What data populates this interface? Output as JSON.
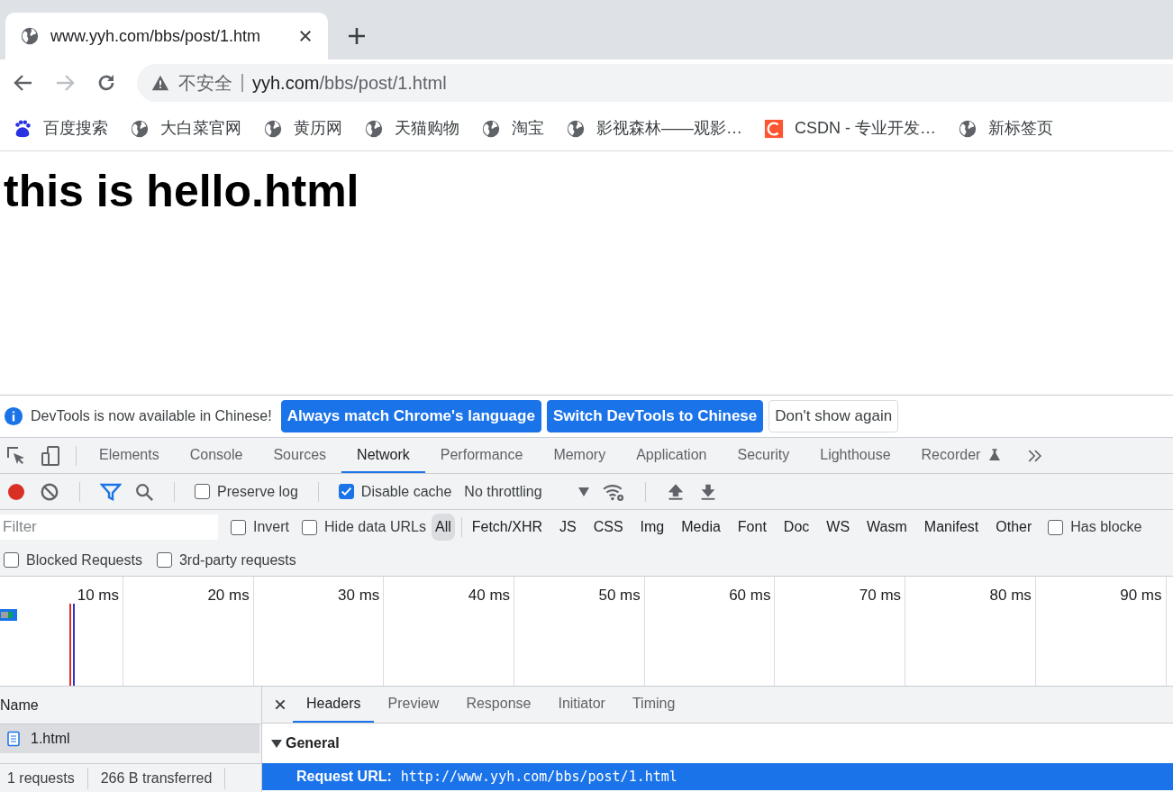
{
  "browser_tabs": [
    {
      "title": "www.yyh.com/bbs/post/1.htm",
      "selected": true
    }
  ],
  "address_bar": {
    "security": "不安全",
    "host": "yyh.com",
    "path": "/bbs/post/1.html"
  },
  "bookmarks": [
    {
      "label": "百度搜索",
      "kind": "baidu"
    },
    {
      "label": "大白菜官网",
      "kind": "globe"
    },
    {
      "label": "黄历网",
      "kind": "globe"
    },
    {
      "label": "天猫购物",
      "kind": "globe"
    },
    {
      "label": "淘宝",
      "kind": "globe"
    },
    {
      "label": "影视森林——观影…",
      "kind": "globe"
    },
    {
      "label": "CSDN - 专业开发…",
      "kind": "csdn"
    },
    {
      "label": "新标签页",
      "kind": "globe"
    }
  ],
  "page": {
    "heading": "this is hello.html"
  },
  "devtools": {
    "infobar": {
      "message": "DevTools is now available in Chinese!",
      "buttons": [
        {
          "label": "Always match Chrome's language",
          "kind": "primary"
        },
        {
          "label": "Switch DevTools to Chinese",
          "kind": "primary"
        },
        {
          "label": "Don't show again",
          "kind": "secondary"
        }
      ]
    },
    "panel_tabs": [
      {
        "label": "Elements",
        "selected": false
      },
      {
        "label": "Console",
        "selected": false
      },
      {
        "label": "Sources",
        "selected": false
      },
      {
        "label": "Network",
        "selected": true
      },
      {
        "label": "Performance",
        "selected": false
      },
      {
        "label": "Memory",
        "selected": false
      },
      {
        "label": "Application",
        "selected": false
      },
      {
        "label": "Security",
        "selected": false
      },
      {
        "label": "Lighthouse",
        "selected": false
      },
      {
        "label": "Recorder",
        "selected": false,
        "experimental": true
      }
    ],
    "toolbar": {
      "recording": true,
      "options": [
        {
          "label": "Preserve log",
          "checked": false
        },
        {
          "label": "Disable cache",
          "checked": true
        }
      ],
      "throttling": "No throttling"
    },
    "filter": {
      "placeholder": "Filter",
      "options": [
        {
          "label": "Invert",
          "checked": false
        },
        {
          "label": "Hide data URLs",
          "checked": false
        }
      ],
      "types": [
        {
          "label": "All",
          "selected": true
        },
        {
          "label": "Fetch/XHR",
          "selected": false
        },
        {
          "label": "JS",
          "selected": false
        },
        {
          "label": "CSS",
          "selected": false
        },
        {
          "label": "Img",
          "selected": false
        },
        {
          "label": "Media",
          "selected": false
        },
        {
          "label": "Font",
          "selected": false
        },
        {
          "label": "Doc",
          "selected": false
        },
        {
          "label": "WS",
          "selected": false
        },
        {
          "label": "Wasm",
          "selected": false
        },
        {
          "label": "Manifest",
          "selected": false
        },
        {
          "label": "Other",
          "selected": false
        }
      ],
      "more_options": [
        {
          "label": "Has blocke",
          "checked": false
        }
      ],
      "second_row": [
        {
          "label": "Blocked Requests",
          "checked": false
        },
        {
          "label": "3rd-party requests",
          "checked": false
        }
      ]
    },
    "timeline": {
      "ticks": [
        "10 ms",
        "20 ms",
        "30 ms",
        "40 ms",
        "50 ms",
        "60 ms",
        "70 ms",
        "80 ms",
        "90 ms"
      ]
    },
    "requests": {
      "column": "Name",
      "rows": [
        {
          "name": "1.html",
          "selected": true
        }
      ],
      "status": [
        "1 requests",
        "266 B transferred"
      ]
    },
    "details": {
      "tabs": [
        {
          "label": "Headers",
          "selected": true
        },
        {
          "label": "Preview",
          "selected": false
        },
        {
          "label": "Response",
          "selected": false
        },
        {
          "label": "Initiator",
          "selected": false
        },
        {
          "label": "Timing",
          "selected": false
        }
      ],
      "section": {
        "title": "General",
        "expanded": true
      },
      "rows": [
        {
          "label": "Request URL:",
          "value": "http://www.yyh.com/bbs/post/1.html",
          "selected": true
        }
      ]
    }
  }
}
